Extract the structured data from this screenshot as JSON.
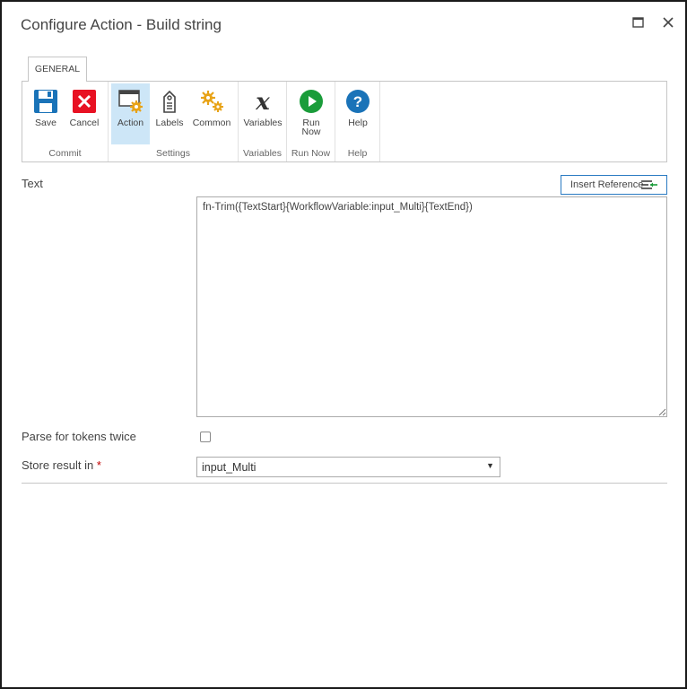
{
  "window": {
    "title": "Configure Action - Build string",
    "maximize_icon": "maximize-icon",
    "close_icon": "close-icon"
  },
  "ribbon": {
    "tabs": [
      {
        "label": "GENERAL"
      }
    ],
    "groups": {
      "commit": {
        "label": "Commit",
        "buttons": [
          {
            "label": "Save",
            "icon": "save-icon",
            "color": "#1a73b8"
          },
          {
            "label": "Cancel",
            "icon": "cancel-icon",
            "color": "#e81123"
          }
        ]
      },
      "settings": {
        "label": "Settings",
        "buttons": [
          {
            "label": "Action",
            "icon": "action-gear-icon",
            "selected": true
          },
          {
            "label": "Labels",
            "icon": "labels-tag-icon"
          },
          {
            "label": "Common",
            "icon": "common-gears-icon"
          }
        ]
      },
      "variables": {
        "label": "Variables",
        "buttons": [
          {
            "label": "Variables",
            "icon": "variables-x-icon"
          }
        ]
      },
      "run_now": {
        "label": "Run Now",
        "buttons": [
          {
            "label": "Run Now",
            "label_lines": [
              "Run",
              "Now"
            ],
            "icon": "run-now-play-icon",
            "color": "#1a9c3a"
          }
        ]
      },
      "help": {
        "label": "Help",
        "buttons": [
          {
            "label": "Help",
            "icon": "help-question-icon",
            "color": "#1a73b8"
          }
        ]
      }
    }
  },
  "form": {
    "text": {
      "label": "Text",
      "insert_reference_label": "Insert Reference",
      "value": "fn-Trim({TextStart}{WorkflowVariable:input_Multi}{TextEnd})"
    },
    "parse_twice": {
      "label": "Parse for tokens twice",
      "checked": false
    },
    "store_result": {
      "label": "Store result in",
      "required_marker": "*",
      "selected": "input_Multi"
    }
  },
  "colors": {
    "accent_blue": "#2a7ac2",
    "selected_bg": "#cde6f7",
    "gear_gold": "#e8a317"
  }
}
